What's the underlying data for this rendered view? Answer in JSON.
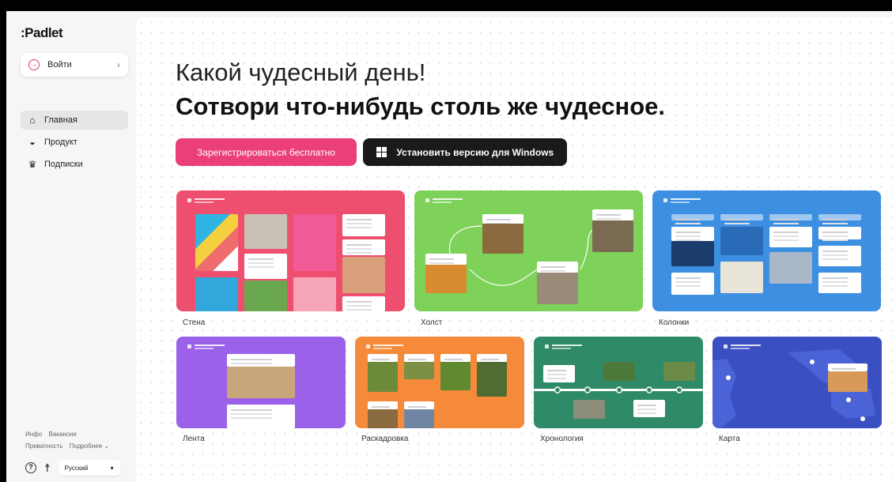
{
  "sidebar": {
    "logo": ":Padlet",
    "login_label": "Войти",
    "nav": [
      {
        "label": "Главная",
        "icon": "home-icon",
        "active": true
      },
      {
        "label": "Продукт",
        "icon": "product-icon",
        "active": false
      },
      {
        "label": "Подписки",
        "icon": "crown-icon",
        "active": false
      }
    ],
    "footer_links": {
      "info": "Инфо",
      "jobs": "Вакансии",
      "privacy": "Приватность",
      "more": "Подробнее ⌄"
    },
    "language": "Русский"
  },
  "main": {
    "greeting": "Какой чудесный день!",
    "headline": "Сотвори что-нибудь столь же чудесное.",
    "signup_label": "Зарегистрироваться бесплатно",
    "install_label": "Установить версию для Windows"
  },
  "templates": [
    {
      "label": "Стена",
      "color": "#ef4f6e"
    },
    {
      "label": "Холст",
      "color": "#7ed159"
    },
    {
      "label": "Колонки",
      "color": "#3d8fe2"
    },
    {
      "label": "Лента",
      "color": "#9b62e9"
    },
    {
      "label": "Раскадровка",
      "color": "#f58a3b"
    },
    {
      "label": "Хронология",
      "color": "#2f8a67"
    },
    {
      "label": "Карта",
      "color": "#3a4fc2"
    }
  ]
}
